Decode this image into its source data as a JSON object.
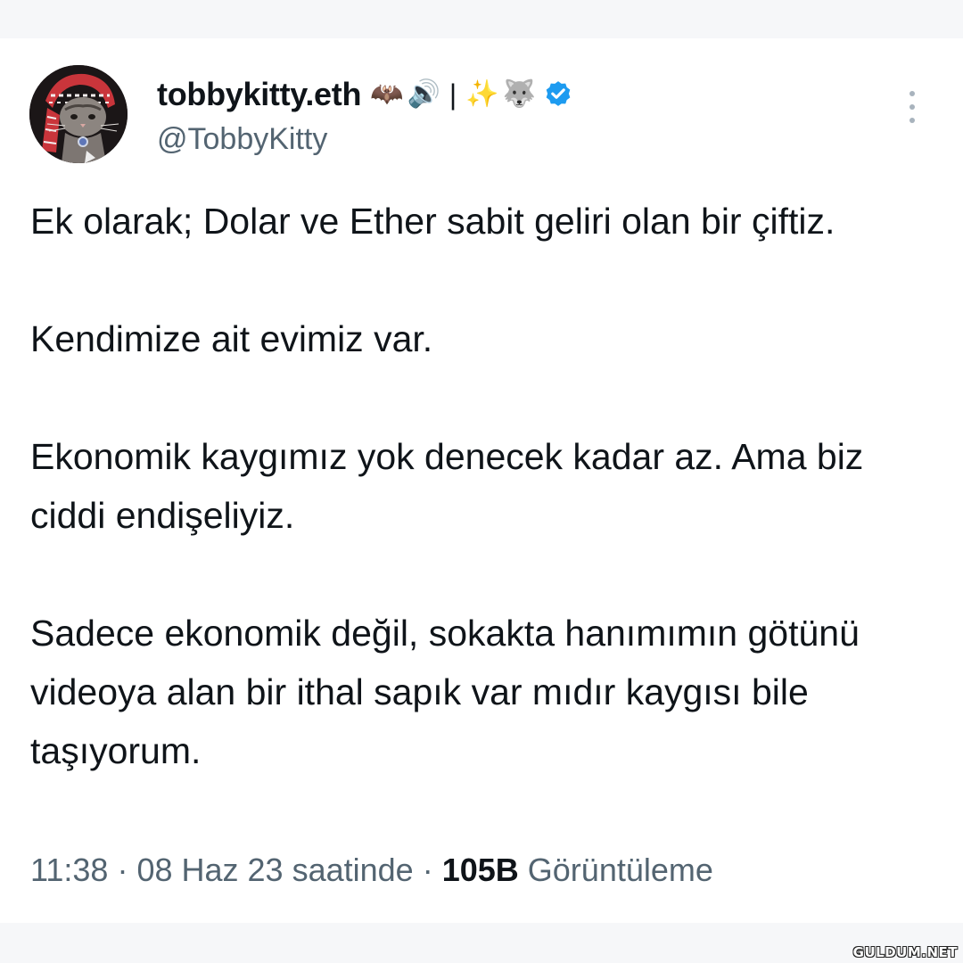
{
  "tweet": {
    "author": {
      "display_name": "tobbykitty.eth",
      "name_emojis_left": [
        "🦇",
        "🔊"
      ],
      "name_separator": "|",
      "name_emojis_right": [
        "✨",
        "🐺"
      ],
      "handle": "@TobbyKitty",
      "verified_color": "#1d9bf0"
    },
    "paragraphs": [
      "Ek olarak; Dolar ve Ether sabit geliri olan bir çiftiz.",
      "Kendimize ait evimiz var.",
      "Ekonomik kaygımız yok denecek kadar az. Ama biz ciddi endişeliyiz.",
      "Sadece ekonomik değil, sokakta hanımımın götünü videoya alan bir ithal sapık var mıdır kaygısı bile taşıyorum."
    ],
    "meta": {
      "time": "11:38",
      "date": "08 Haz 23 saatinde",
      "separator": "·",
      "views_count": "105B",
      "views_label": "Görüntüleme"
    }
  },
  "watermark": "GULDUM.NET"
}
